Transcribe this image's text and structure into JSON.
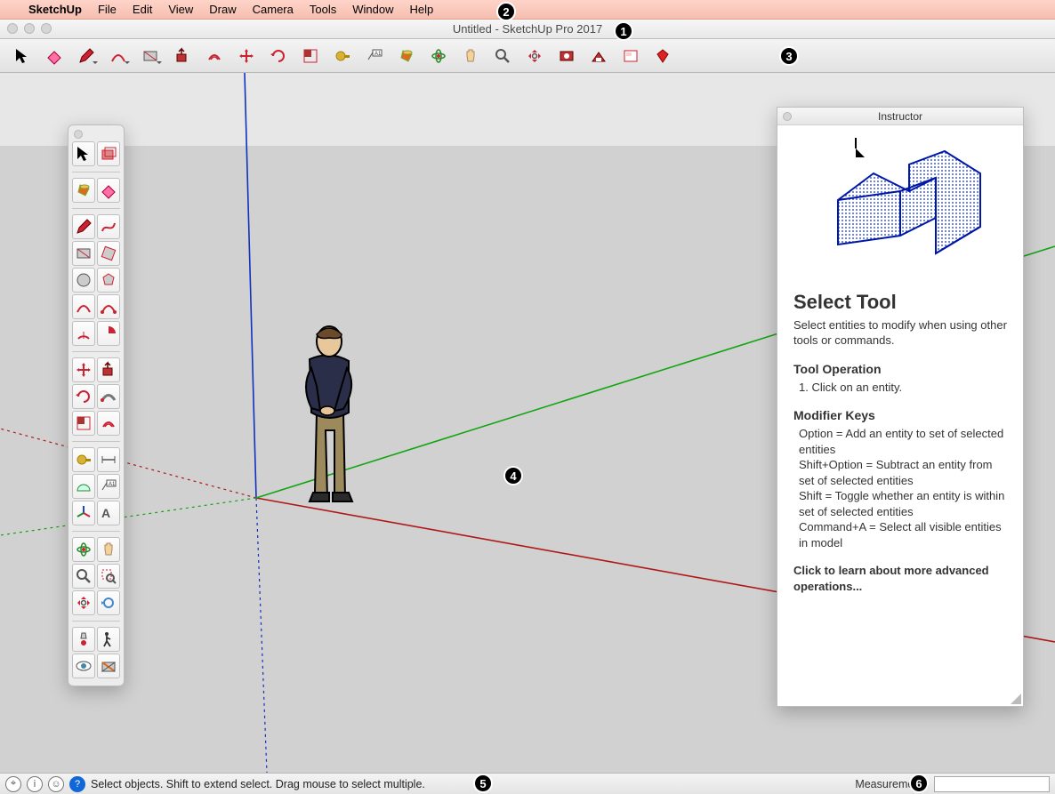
{
  "menubar": {
    "app": "SketchUp",
    "items": [
      "File",
      "Edit",
      "View",
      "Draw",
      "Camera",
      "Tools",
      "Window",
      "Help"
    ]
  },
  "window": {
    "title": "Untitled - SketchUp Pro 2017"
  },
  "main_toolbar": [
    {
      "name": "select-tool",
      "glyph": "cursor",
      "dd": false
    },
    {
      "name": "eraser-tool",
      "glyph": "eraser-pink",
      "dd": false
    },
    {
      "name": "line-tool",
      "glyph": "pencil",
      "dd": true
    },
    {
      "name": "arc-tool",
      "glyph": "arc",
      "dd": true
    },
    {
      "name": "shape-tool",
      "glyph": "rect",
      "dd": true
    },
    {
      "name": "pushpull-tool",
      "glyph": "pushpull",
      "dd": false
    },
    {
      "name": "offset-tool",
      "glyph": "offset",
      "dd": false
    },
    {
      "name": "move-tool",
      "glyph": "move",
      "dd": false
    },
    {
      "name": "rotate-tool",
      "glyph": "rotate",
      "dd": false
    },
    {
      "name": "scale-tool",
      "glyph": "scale",
      "dd": false
    },
    {
      "name": "tape-tool",
      "glyph": "tape",
      "dd": false
    },
    {
      "name": "text-tool",
      "glyph": "text",
      "dd": false
    },
    {
      "name": "paint-tool",
      "glyph": "bucket",
      "dd": false
    },
    {
      "name": "orbit-tool",
      "glyph": "orbit",
      "dd": false
    },
    {
      "name": "pan-tool",
      "glyph": "pan",
      "dd": false
    },
    {
      "name": "zoom-tool",
      "glyph": "zoom",
      "dd": false
    },
    {
      "name": "zoom-extents-tool",
      "glyph": "zoomext",
      "dd": false
    },
    {
      "name": "add-location-tool",
      "glyph": "location",
      "dd": false
    },
    {
      "name": "warehouse-tool",
      "glyph": "warehouse",
      "dd": false
    },
    {
      "name": "layout-tool",
      "glyph": "layout",
      "dd": false
    },
    {
      "name": "extension-warehouse-tool",
      "glyph": "ruby",
      "dd": false
    }
  ],
  "palette": {
    "groups": [
      [
        {
          "name": "select-tool",
          "glyph": "cursor"
        },
        {
          "name": "make-component",
          "glyph": "component"
        }
      ],
      [
        {
          "name": "paint-bucket-tool",
          "glyph": "bucket"
        },
        {
          "name": "eraser-tool",
          "glyph": "eraser-pink"
        }
      ],
      [
        {
          "name": "line-tool",
          "glyph": "pencil"
        },
        {
          "name": "freehand-tool",
          "glyph": "freehand"
        },
        {
          "name": "rectangle-tool",
          "glyph": "rect"
        },
        {
          "name": "rotated-rect-tool",
          "glyph": "rotrect"
        },
        {
          "name": "circle-tool",
          "glyph": "circle"
        },
        {
          "name": "polygon-tool",
          "glyph": "polygon"
        },
        {
          "name": "arc-tool",
          "glyph": "arc"
        },
        {
          "name": "arc2-tool",
          "glyph": "arc2"
        },
        {
          "name": "arc3-tool",
          "glyph": "arc3"
        },
        {
          "name": "pie-tool",
          "glyph": "pie"
        }
      ],
      [
        {
          "name": "move-tool",
          "glyph": "move"
        },
        {
          "name": "pushpull-tool",
          "glyph": "pushpull"
        },
        {
          "name": "rotate-tool",
          "glyph": "rotate"
        },
        {
          "name": "followme-tool",
          "glyph": "followme"
        },
        {
          "name": "scale-tool",
          "glyph": "scale"
        },
        {
          "name": "offset-tool",
          "glyph": "offset"
        }
      ],
      [
        {
          "name": "tape-tool",
          "glyph": "tape"
        },
        {
          "name": "dimension-tool",
          "glyph": "dim"
        },
        {
          "name": "protractor-tool",
          "glyph": "protractor"
        },
        {
          "name": "text-tool",
          "glyph": "text"
        },
        {
          "name": "axes-tool",
          "glyph": "axes"
        },
        {
          "name": "3dtext-tool",
          "glyph": "3dtext"
        }
      ],
      [
        {
          "name": "orbit-tool",
          "glyph": "orbit"
        },
        {
          "name": "pan-tool",
          "glyph": "pan"
        },
        {
          "name": "zoom-tool",
          "glyph": "zoom"
        },
        {
          "name": "zoom-window-tool",
          "glyph": "zoomwin"
        },
        {
          "name": "zoom-extents-tool",
          "glyph": "zoomext"
        },
        {
          "name": "previous-tool",
          "glyph": "prev"
        }
      ],
      [
        {
          "name": "position-camera-tool",
          "glyph": "poscam"
        },
        {
          "name": "walk-tool",
          "glyph": "walk"
        },
        {
          "name": "look-around-tool",
          "glyph": "look"
        },
        {
          "name": "section-plane-tool",
          "glyph": "section"
        }
      ]
    ]
  },
  "instructor": {
    "title": "Instructor",
    "heading": "Select Tool",
    "desc": "Select entities to modify when using other tools or commands.",
    "op_heading": "Tool Operation",
    "op_steps": "1. Click on an entity.",
    "mod_heading": "Modifier Keys",
    "mod_lines": [
      "Option = Add an entity to set of selected entities",
      "Shift+Option = Subtract an entity from set of selected entities",
      "Shift = Toggle whether an entity is within set of selected entities",
      "Command+A = Select all visible entities in model"
    ],
    "more": "Click to learn about more advanced operations..."
  },
  "statusbar": {
    "hint": "Select objects. Shift to extend select. Drag mouse to select multiple.",
    "measurements_label": "Measurements",
    "measurements_value": ""
  },
  "callouts": [
    "1",
    "2",
    "3",
    "4",
    "5",
    "6"
  ]
}
